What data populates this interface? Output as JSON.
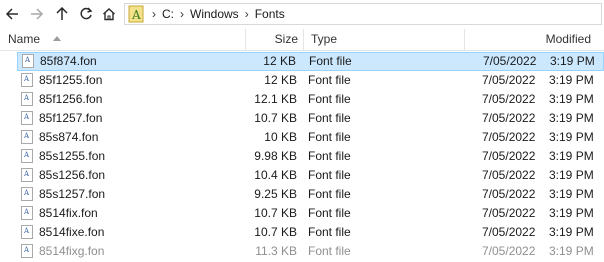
{
  "toolbar": {
    "breadcrumbs": [
      "C:",
      "Windows",
      "Fonts"
    ]
  },
  "columns": {
    "name": "Name",
    "size": "Size",
    "type": "Type",
    "modified": "Modified"
  },
  "files": [
    {
      "name": "85f874.fon",
      "size": "12 KB",
      "type": "Font file",
      "date": "7/05/2022",
      "time": "3:19 PM"
    },
    {
      "name": "85f1255.fon",
      "size": "12 KB",
      "type": "Font file",
      "date": "7/05/2022",
      "time": "3:19 PM"
    },
    {
      "name": "85f1256.fon",
      "size": "12.1 KB",
      "type": "Font file",
      "date": "7/05/2022",
      "time": "3:19 PM"
    },
    {
      "name": "85f1257.fon",
      "size": "10.7 KB",
      "type": "Font file",
      "date": "7/05/2022",
      "time": "3:19 PM"
    },
    {
      "name": "85s874.fon",
      "size": "10 KB",
      "type": "Font file",
      "date": "7/05/2022",
      "time": "3:19 PM"
    },
    {
      "name": "85s1255.fon",
      "size": "9.98 KB",
      "type": "Font file",
      "date": "7/05/2022",
      "time": "3:19 PM"
    },
    {
      "name": "85s1256.fon",
      "size": "10.4 KB",
      "type": "Font file",
      "date": "7/05/2022",
      "time": "3:19 PM"
    },
    {
      "name": "85s1257.fon",
      "size": "9.25 KB",
      "type": "Font file",
      "date": "7/05/2022",
      "time": "3:19 PM"
    },
    {
      "name": "8514fix.fon",
      "size": "10.7 KB",
      "type": "Font file",
      "date": "7/05/2022",
      "time": "3:19 PM"
    },
    {
      "name": "8514fixe.fon",
      "size": "10.7 KB",
      "type": "Font file",
      "date": "7/05/2022",
      "time": "3:19 PM"
    },
    {
      "name": "8514fixg.fon",
      "size": "11.3 KB",
      "type": "Font file",
      "date": "7/05/2022",
      "time": "3:19 PM"
    }
  ],
  "selected_index": 0,
  "colors": {
    "selection_bg": "#cce8ff",
    "selection_border": "#99d1ff"
  }
}
